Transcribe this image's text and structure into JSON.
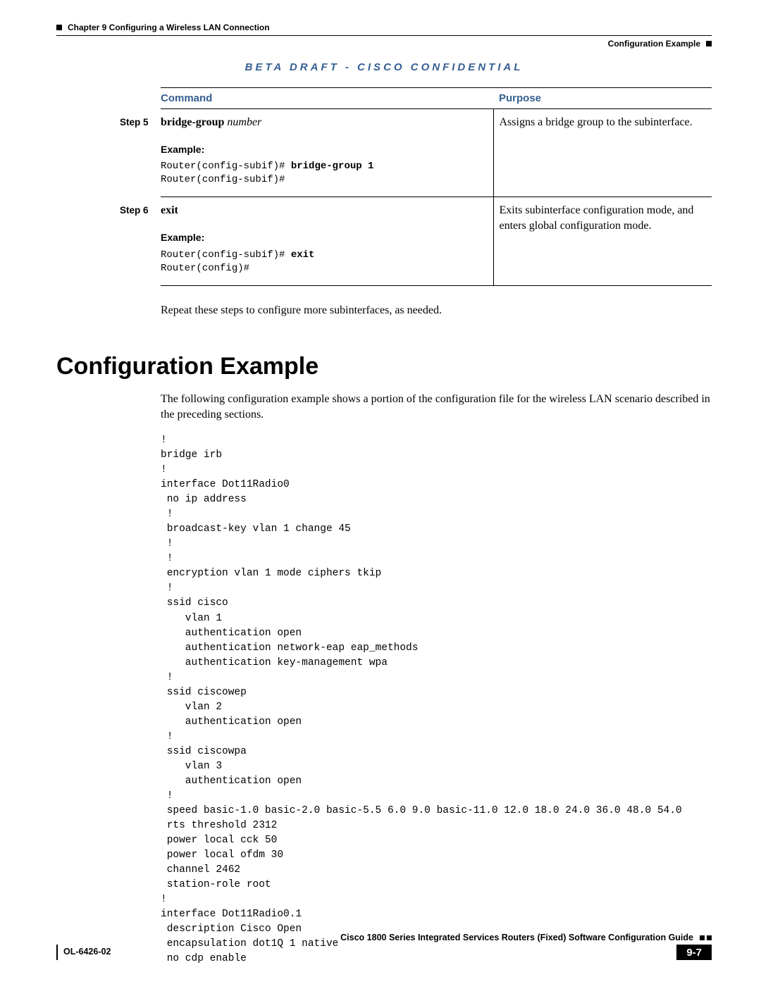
{
  "header": {
    "chapter": "Chapter 9    Configuring a Wireless LAN Connection",
    "section": "Configuration Example"
  },
  "confidential": "BETA DRAFT - CISCO CONFIDENTIAL",
  "table": {
    "head_command": "Command",
    "head_purpose": "Purpose",
    "rows": [
      {
        "step": "Step 5",
        "cmd_bold": "bridge-group",
        "cmd_ital": " number",
        "example_label": "Example:",
        "example_line1_a": "Router(config-subif)# ",
        "example_line1_b": "bridge-group 1",
        "example_line2": "Router(config-subif)#",
        "purpose": "Assigns a bridge group to the subinterface."
      },
      {
        "step": "Step 6",
        "cmd_bold": "exit",
        "cmd_ital": "",
        "example_label": "Example:",
        "example_line1_a": "Router(config-subif)# ",
        "example_line1_b": "exit",
        "example_line2": "Router(config)#",
        "purpose": "Exits subinterface configuration mode, and enters global configuration mode."
      }
    ]
  },
  "repeat_note": "Repeat these steps to configure more subinterfaces, as needed.",
  "section_title": "Configuration Example",
  "section_intro": "The following configuration example shows a portion of the configuration file for the wireless LAN scenario described in the preceding sections.",
  "config_block": "!\nbridge irb\n!\ninterface Dot11Radio0\n no ip address\n !\n broadcast-key vlan 1 change 45\n !\n !\n encryption vlan 1 mode ciphers tkip\n !\n ssid cisco\n    vlan 1\n    authentication open\n    authentication network-eap eap_methods\n    authentication key-management wpa\n !\n ssid ciscowep\n    vlan 2\n    authentication open\n !\n ssid ciscowpa\n    vlan 3\n    authentication open\n !\n speed basic-1.0 basic-2.0 basic-5.5 6.0 9.0 basic-11.0 12.0 18.0 24.0 36.0 48.0 54.0\n rts threshold 2312\n power local cck 50\n power local ofdm 30\n channel 2462\n station-role root\n!\ninterface Dot11Radio0.1\n description Cisco Open\n encapsulation dot1Q 1 native\n no cdp enable",
  "footer": {
    "book": "Cisco 1800 Series Integrated Services Routers (Fixed) Software Configuration Guide",
    "docnum": "OL-6426-02",
    "page": "9-7"
  }
}
